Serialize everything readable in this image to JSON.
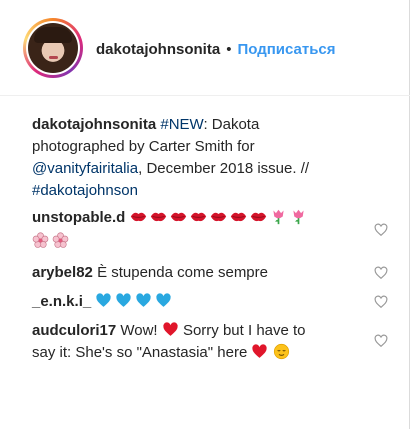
{
  "post": {
    "author": "dakotajohnsonita",
    "follow_label": "Подписаться",
    "separator": "•"
  },
  "caption": {
    "user": "dakotajohnsonita",
    "line1_tag": "#NEW",
    "line1_rest": ": Dakota",
    "line2": "photographed by Carter Smith for",
    "line3_mention": "@vanityfairitalia",
    "line3_rest": ", December 2018 issue. //",
    "line4_tag": "#dakotajohnson"
  },
  "comments": [
    {
      "user": "unstopable.d",
      "emojis": [
        "lips",
        "lips",
        "lips",
        "lips",
        "lips",
        "lips",
        "lips",
        "tulip",
        "tulip",
        "cherry-blossom",
        "cherry-blossom"
      ]
    },
    {
      "user": "arybel82",
      "text": "È stupenda come sempre"
    },
    {
      "user": "_e.n.k.i_",
      "emojis": [
        "blue-heart",
        "blue-heart",
        "blue-heart",
        "blue-heart"
      ]
    },
    {
      "user": "audculori17",
      "text_a": "Wow!",
      "text_b": "Sorry but I have to",
      "text_c": "say it: She's so \"Anastasia\" here"
    }
  ],
  "colors": {
    "link": "#003569",
    "follow": "#3897f0",
    "text": "#262626",
    "red_heart": "#e0162b",
    "blue_heart": "#29a8e0"
  }
}
